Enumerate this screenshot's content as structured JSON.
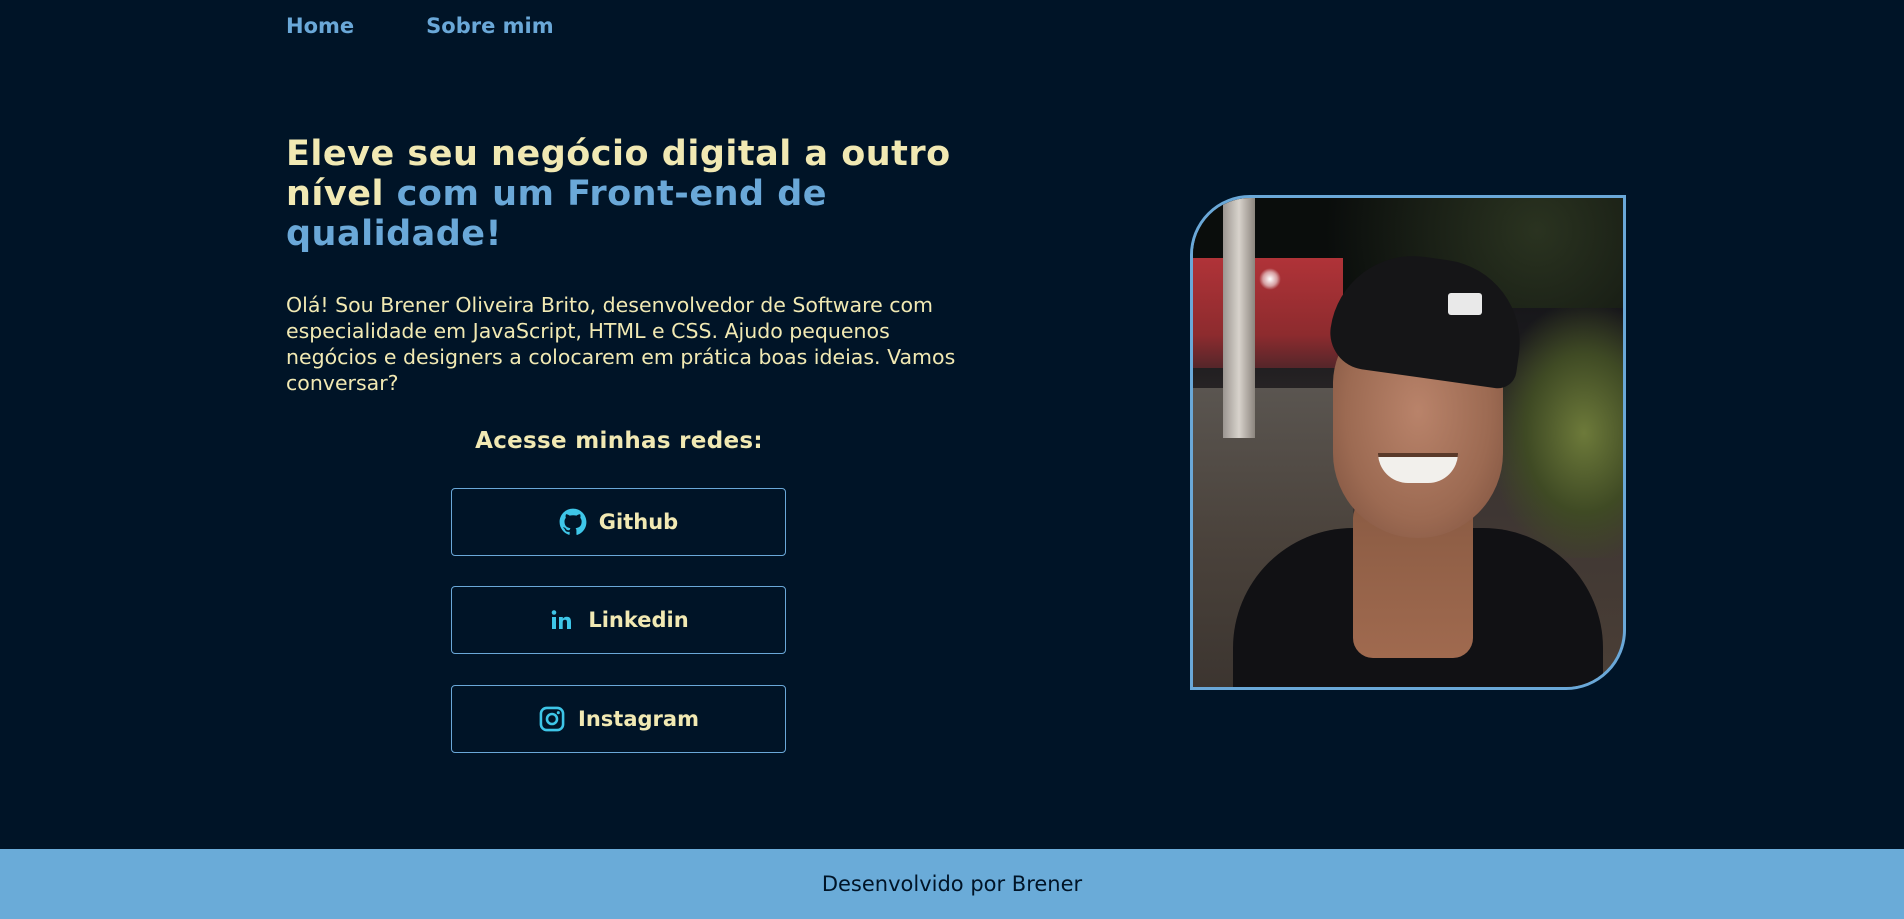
{
  "nav": {
    "home": "Home",
    "about": "Sobre mim"
  },
  "hero": {
    "title_part1": "Eleve seu negócio digital a outro nível ",
    "title_part2": "com um Front-end de qualidade!",
    "intro": "Olá! Sou Brener Oliveira Brito, desenvolvedor de Software com especialidade em JavaScript, HTML e CSS. Ajudo pequenos negócios e designers a colocarem em prática boas ideias. Vamos conversar?"
  },
  "social": {
    "heading": "Acesse minhas redes:",
    "buttons": [
      {
        "label": "Github",
        "icon": "github-icon"
      },
      {
        "label": "Linkedin",
        "icon": "linkedin-icon"
      },
      {
        "label": "Instagram",
        "icon": "instagram-icon"
      }
    ]
  },
  "footer": {
    "text": "Desenvolvido por Brener"
  },
  "colors": {
    "background": "#001427",
    "accent_blue": "#6aa8d8",
    "cream": "#f1e9b3",
    "icon_cyan": "#3ec6e8",
    "footer_bg": "#6aabd8"
  }
}
